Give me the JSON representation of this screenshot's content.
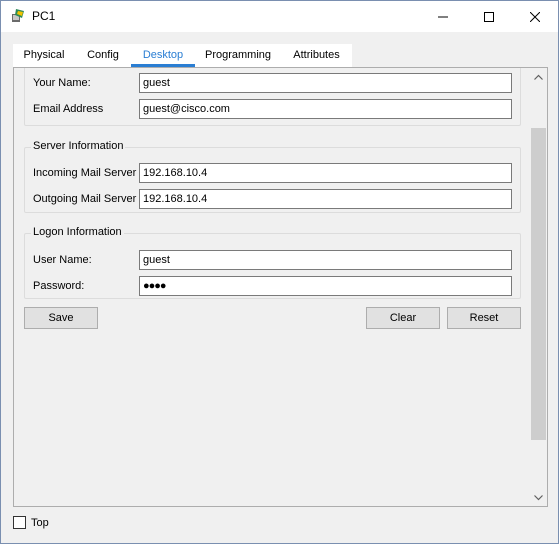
{
  "window": {
    "title": "PC1",
    "icon": "pc-device-icon"
  },
  "tabs": [
    {
      "label": "Physical",
      "active": false
    },
    {
      "label": "Config",
      "active": false
    },
    {
      "label": "Desktop",
      "active": true
    },
    {
      "label": "Programming",
      "active": false
    },
    {
      "label": "Attributes",
      "active": false
    }
  ],
  "user_info": {
    "your_name_label": "Your Name:",
    "your_name_value": "guest",
    "email_label": "Email Address",
    "email_value": "guest@cisco.com"
  },
  "server_info": {
    "title": "Server Information",
    "incoming_label": "Incoming Mail Server",
    "incoming_value": "192.168.10.4",
    "outgoing_label": "Outgoing Mail Server",
    "outgoing_value": "192.168.10.4"
  },
  "logon_info": {
    "title": "Logon Information",
    "user_label": "User Name:",
    "user_value": "guest",
    "password_label": "Password:",
    "password_value": "●●●●"
  },
  "buttons": {
    "save": "Save",
    "clear": "Clear",
    "reset": "Reset"
  },
  "footer": {
    "top_label": "Top",
    "top_checked": false
  },
  "colors": {
    "accent": "#2a7ed3"
  }
}
